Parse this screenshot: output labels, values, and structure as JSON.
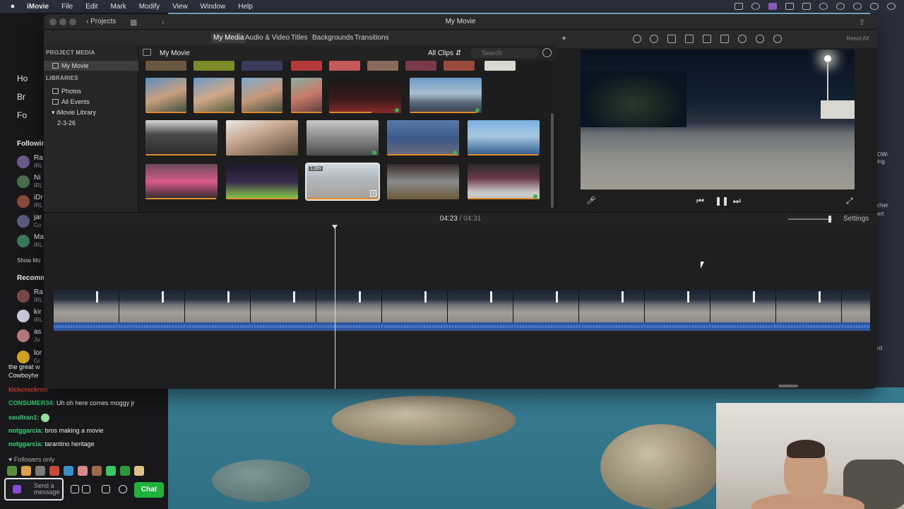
{
  "menubar": {
    "app": "iMovie",
    "items": [
      "File",
      "Edit",
      "Mark",
      "Modify",
      "View",
      "Window",
      "Help"
    ]
  },
  "stream_sidebar": {
    "nav": [
      "Ho",
      "Br",
      "Fo"
    ],
    "following_head": "Followin",
    "follows": [
      {
        "name": "Ra",
        "sub": "IRL"
      },
      {
        "name": "Ni",
        "sub": "IRL"
      },
      {
        "name": "iDr",
        "sub": "IRL"
      },
      {
        "name": "jar",
        "sub": "Co"
      },
      {
        "name": "Ma",
        "sub": "IRL"
      }
    ],
    "show_more": "Show Mo",
    "recommended_head": "Recomm",
    "recommended": [
      {
        "name": "Ra",
        "sub": "IRL"
      },
      {
        "name": "kir",
        "sub": "IRL"
      },
      {
        "name": "as",
        "sub": "Ju"
      },
      {
        "name": "lor",
        "sub": "Gr"
      }
    ],
    "chat_partial_1": "the great w",
    "chat_partial_2": "Cowboyhe",
    "chat": [
      {
        "user": "kickcrackrott",
        "text": "",
        "cls": "u1"
      },
      {
        "user": "CONSUMER34:",
        "text": "Uh oh here comes moggy jr",
        "cls": "u2"
      },
      {
        "user": "soultran1:",
        "text": "",
        "cls": "u3"
      },
      {
        "user": "notggarcia:",
        "text": "bros making a movie",
        "cls": "u3"
      },
      {
        "user": "notggarcia:",
        "text": "tarantino heritage",
        "cls": "u3"
      }
    ],
    "followers_only": "Followers only",
    "chat_placeholder": "Send a message",
    "chat_button": "Chat"
  },
  "right_side": {
    "labels": [
      "OW-",
      "ing",
      "cher",
      "ert",
      "rd"
    ]
  },
  "window": {
    "title": "My Movie",
    "projects_label": "Projects"
  },
  "media_tabs": [
    "My Media",
    "Audio & Video",
    "Titles",
    "Backgrounds",
    "Transitions"
  ],
  "library": {
    "project_media_head": "PROJECT MEDIA",
    "project_item": "My Movie",
    "libraries_head": "LIBRARIES",
    "items": [
      "Photos",
      "All Events",
      "iMovie Library",
      "2-3-26"
    ]
  },
  "media_header": {
    "title": "My Movie",
    "filter": "All Clips",
    "search_placeholder": "Search"
  },
  "clips": {
    "selected_duration": "1.0m"
  },
  "viewer": {
    "reset_all": "Reset All"
  },
  "timeline": {
    "current": "04:23",
    "separator": "/",
    "total": "04:31",
    "settings": "Settings",
    "zoom_level": 0.95,
    "playhead_fraction": 0.355
  }
}
